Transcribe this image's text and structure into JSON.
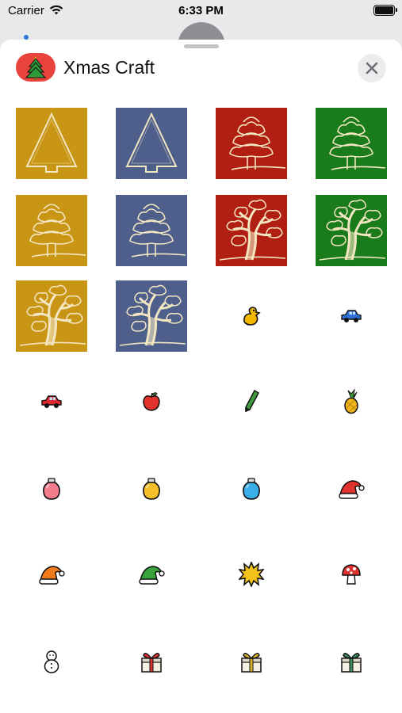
{
  "status_bar": {
    "carrier": "Carrier",
    "time": "6:33 PM"
  },
  "sheet": {
    "title": "Xmas Craft",
    "close_icon": "close-icon"
  },
  "stickers": [
    {
      "kind": "tile",
      "icon": "outline-tree-icon",
      "color": "#c99515"
    },
    {
      "kind": "tile",
      "icon": "outline-tree-icon",
      "color": "#4e5f8c"
    },
    {
      "kind": "tile",
      "icon": "fluffy-tree-icon",
      "color": "#b01f11"
    },
    {
      "kind": "tile",
      "icon": "fluffy-tree-icon",
      "color": "#197b1a"
    },
    {
      "kind": "tile",
      "icon": "fluffy-tree-icon",
      "color": "#c99515"
    },
    {
      "kind": "tile",
      "icon": "fluffy-tree-icon",
      "color": "#4e5f8c"
    },
    {
      "kind": "tile",
      "icon": "branchy-tree-icon",
      "color": "#b01f11"
    },
    {
      "kind": "tile",
      "icon": "branchy-tree-icon",
      "color": "#197b1a"
    },
    {
      "kind": "tile",
      "icon": "branchy-tree-icon",
      "color": "#c99515"
    },
    {
      "kind": "tile",
      "icon": "branchy-tree-icon",
      "color": "#4e5f8c"
    },
    {
      "kind": "sticker",
      "icon": "duck-icon",
      "color": "#f5b800"
    },
    {
      "kind": "sticker",
      "icon": "blue-car-icon",
      "color": "#2f6fd8"
    },
    {
      "kind": "sticker",
      "icon": "red-car-icon",
      "color": "#e0282e"
    },
    {
      "kind": "sticker",
      "icon": "apple-icon",
      "color": "#e0312b"
    },
    {
      "kind": "sticker",
      "icon": "pencil-icon",
      "color": "#3d9a3b"
    },
    {
      "kind": "sticker",
      "icon": "pineapple-icon",
      "color": "#f2b619"
    },
    {
      "kind": "sticker",
      "icon": "pink-ornament-icon",
      "color": "#f47d8d"
    },
    {
      "kind": "sticker",
      "icon": "yellow-ornament-icon",
      "color": "#f5bf2a"
    },
    {
      "kind": "sticker",
      "icon": "blue-ornament-icon",
      "color": "#3aaee8"
    },
    {
      "kind": "sticker",
      "icon": "red-santa-hat-icon",
      "color": "#e0322c"
    },
    {
      "kind": "sticker",
      "icon": "orange-santa-hat-icon",
      "color": "#f07a1a"
    },
    {
      "kind": "sticker",
      "icon": "green-santa-hat-icon",
      "color": "#39a23a"
    },
    {
      "kind": "sticker",
      "icon": "sunburst-icon",
      "color": "#f2c21b"
    },
    {
      "kind": "sticker",
      "icon": "mushroom-icon",
      "color": "#e0322c"
    },
    {
      "kind": "sticker",
      "icon": "snowman-icon",
      "color": "#ffffff"
    },
    {
      "kind": "sticker",
      "icon": "red-ribbon-gift-icon",
      "color": "#e0322c"
    },
    {
      "kind": "sticker",
      "icon": "yellow-ribbon-gift-icon",
      "color": "#d9b52a"
    },
    {
      "kind": "sticker",
      "icon": "green-ribbon-gift-icon",
      "color": "#3a8a5a"
    }
  ]
}
